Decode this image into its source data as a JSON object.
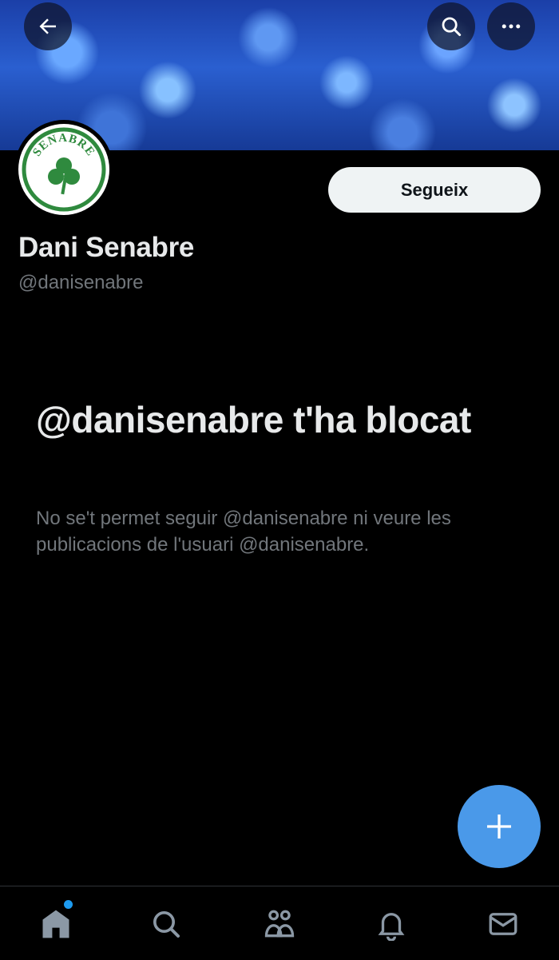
{
  "header": {
    "back_icon": "arrow-left-icon",
    "search_icon": "search-icon",
    "more_icon": "more-horizontal-icon"
  },
  "profile": {
    "avatar_text": "SENABRE",
    "avatar_icon": "shamrock-icon",
    "display_name": "Dani Senabre",
    "handle": "@danisenabre",
    "follow_label": "Segueix"
  },
  "blocked": {
    "title": "@danisenabre t'ha blocat",
    "description": "No se't permet seguir @danisenabre ni veure les publicacions de l'usuari @danisenabre."
  },
  "fab": {
    "icon": "plus-icon"
  },
  "bottom_nav": {
    "items": [
      {
        "icon": "home-icon",
        "active": true,
        "has_dot": true
      },
      {
        "icon": "search-icon"
      },
      {
        "icon": "communities-icon"
      },
      {
        "icon": "bell-icon"
      },
      {
        "icon": "mail-icon"
      }
    ]
  },
  "colors": {
    "background": "#000000",
    "text_primary": "#e7e9ea",
    "text_secondary": "#71767b",
    "accent": "#1d9bf0",
    "fab": "#4a99e9",
    "avatar_green": "#2f8a3e"
  }
}
